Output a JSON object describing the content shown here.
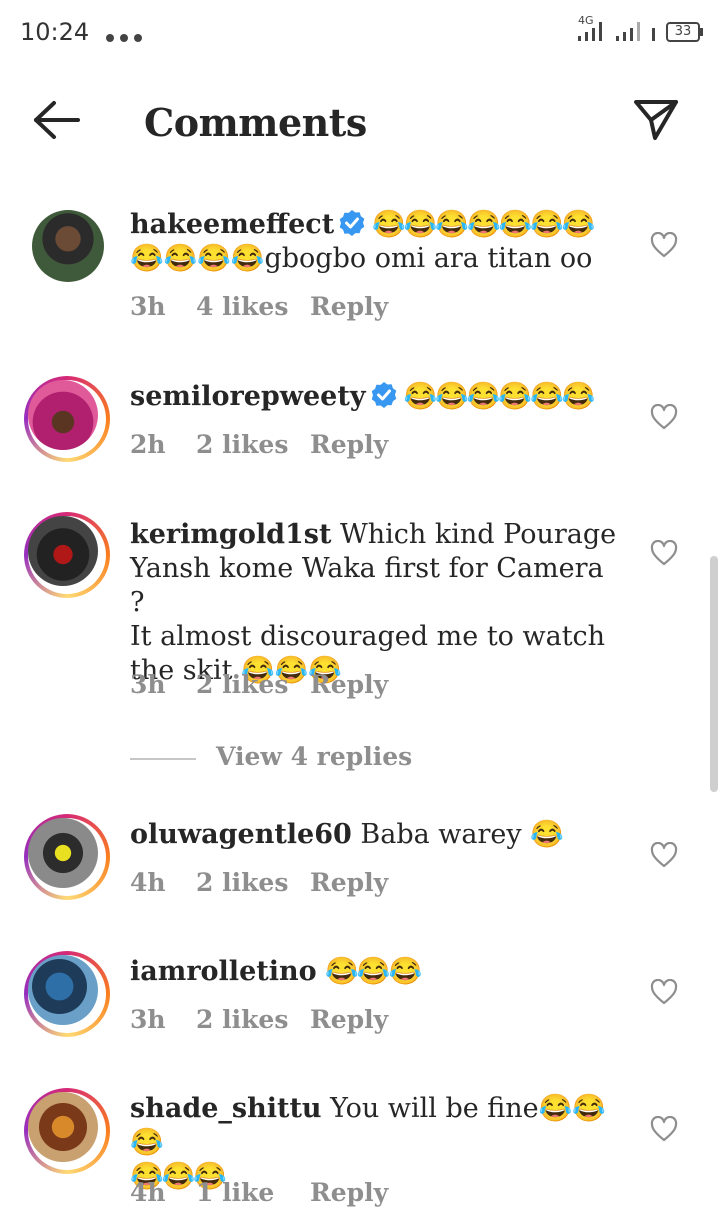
{
  "status": {
    "time": "10:24",
    "network": "4G",
    "battery": "33"
  },
  "header": {
    "title": "Comments",
    "back_icon": "arrow-left-icon",
    "send_icon": "paper-plane-icon"
  },
  "comments": [
    {
      "username": "hakeemeffect",
      "verified": true,
      "text": "😂😂😂😂😂😂😂",
      "text2": "😂😂😂😂gbogbo omi ara titan oo",
      "time": "3h",
      "likes": "4 likes",
      "reply": "Reply"
    },
    {
      "username": "semilorepweety",
      "verified": true,
      "text": "😂😂😂😂😂😂",
      "time": "2h",
      "likes": "2 likes",
      "reply": "Reply"
    },
    {
      "username": "kerimgold1st",
      "verified": false,
      "text": "Which kind Pourage",
      "text2": "Yansh kome Waka first for Camera ?",
      "text3": "It almost discouraged me to watch",
      "text4": "the skit 😂😂😂",
      "time": "3h",
      "likes": "2 likes",
      "reply": "Reply"
    },
    {
      "username": "oluwagentle60",
      "verified": false,
      "text": "Baba warey 😂",
      "time": "4h",
      "likes": "2 likes",
      "reply": "Reply"
    },
    {
      "username": "iamrolletino",
      "verified": false,
      "text": "😂😂😂",
      "time": "3h",
      "likes": "2 likes",
      "reply": "Reply"
    },
    {
      "username": "shade_shittu",
      "verified": false,
      "text": "You will be fine😂😂😂",
      "text2": "😂😂😂",
      "time": "4h",
      "likes": "1 like",
      "reply": "Reply"
    }
  ],
  "view_replies": "View 4 replies",
  "colors": {
    "verified": "#3897f0",
    "secondary": "#8e8e8e",
    "primary": "#262626"
  }
}
